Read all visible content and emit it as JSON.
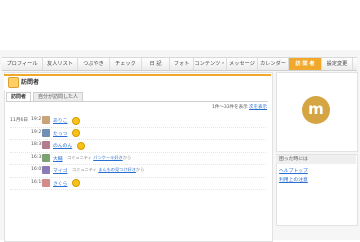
{
  "nav": {
    "items": [
      {
        "label": "プロフィール",
        "active": false
      },
      {
        "label": "友人リスト",
        "active": false
      },
      {
        "label": "つぶやき",
        "active": false
      },
      {
        "label": "チェック",
        "active": false
      },
      {
        "label": "日 記",
        "active": false
      },
      {
        "label": "フォト",
        "active": false
      },
      {
        "label": "コンテンツ・",
        "active": false
      },
      {
        "label": "メッセージ",
        "active": false
      },
      {
        "label": "カレンダー",
        "active": false
      },
      {
        "label": "訪 問 者",
        "active": true
      },
      {
        "label": "設定変更",
        "active": false
      }
    ]
  },
  "page": {
    "title": "訪問者",
    "tabs": [
      "訪問者",
      "自分が訪問した人"
    ],
    "range_text": "1件〜33件を表示",
    "range_link": "次を表示"
  },
  "visitors": [
    {
      "date": "11月6日",
      "time": "19:27",
      "name": "ありこ",
      "note": "",
      "community": "",
      "suffix": "",
      "smile": true,
      "avatar_color": "#c9a47a"
    },
    {
      "date": "",
      "time": "19:21",
      "name": "たっつ",
      "note": "",
      "community": "",
      "suffix": "",
      "smile": true,
      "avatar_color": "#6f8fb5"
    },
    {
      "date": "",
      "time": "18:38",
      "name": "のんのん",
      "note": "",
      "community": "",
      "suffix": "",
      "smile": true,
      "avatar_color": "#b57a8f"
    },
    {
      "date": "",
      "time": "16:35",
      "name": "大輔",
      "note": "コミュニティ ",
      "community": "パンケーキ好き",
      "suffix": "から",
      "smile": false,
      "avatar_color": "#7aa36f"
    },
    {
      "date": "",
      "time": "16:05",
      "name": "マイゴ",
      "note": "コミュニティ ",
      "community": "まんもの見つけ好き",
      "suffix": "から",
      "smile": false,
      "avatar_color": "#8a7ab5"
    },
    {
      "date": "",
      "time": "16:18",
      "name": "さくら",
      "note": "",
      "community": "",
      "suffix": "",
      "smile": true,
      "avatar_color": "#d28a8a"
    }
  ],
  "sidebar": {
    "logo_letter": "m",
    "help_title": "困った時には",
    "help_links": [
      "ヘルプトップ",
      "利用上の注意"
    ]
  },
  "colors": {
    "accent": "#f0a92b",
    "link": "#2a6fcf",
    "logo": "#d5a443"
  }
}
